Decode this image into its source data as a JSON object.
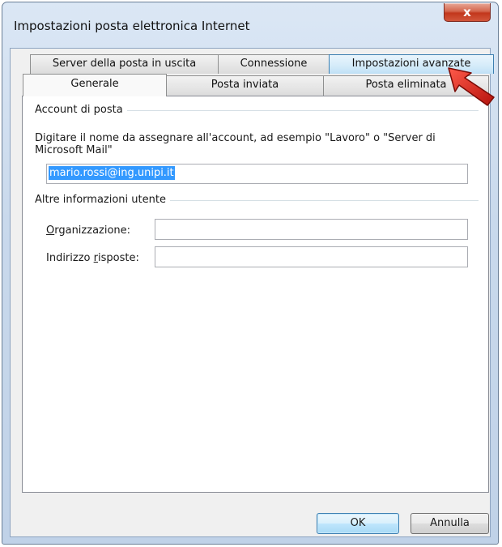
{
  "window": {
    "title": "Impostazioni posta elettronica Internet",
    "close_label": "x"
  },
  "tabs": {
    "row1": [
      {
        "label": "Server della posta in uscita"
      },
      {
        "label": "Connessione"
      },
      {
        "label": "Impostazioni avanzate",
        "state": "hover"
      }
    ],
    "row2": [
      {
        "label": "Generale",
        "state": "active"
      },
      {
        "label": "Posta inviata"
      },
      {
        "label": "Posta eliminata"
      }
    ]
  },
  "account": {
    "group_label": "Account di posta",
    "description": "Digitare il nome da assegnare all'account, ad esempio \"Lavoro\" o \"Server di Microsoft Mail\"",
    "name_value": "mario.rossi@ing.unipi.it"
  },
  "other": {
    "group_label": "Altre informazioni utente",
    "org_label_prefix": "",
    "org_label_key": "O",
    "org_label_rest": "rganizzazione:",
    "org_value": "",
    "reply_label_prefix": "Indirizzo ",
    "reply_label_key": "r",
    "reply_label_rest": "isposte:",
    "reply_value": ""
  },
  "buttons": {
    "ok": "OK",
    "cancel": "Annulla"
  },
  "colors": {
    "selection": "#3399ff",
    "pointer": "#e0231b"
  },
  "icons": {
    "close": "close-icon",
    "pointer": "red-arrow-pointer-icon"
  }
}
